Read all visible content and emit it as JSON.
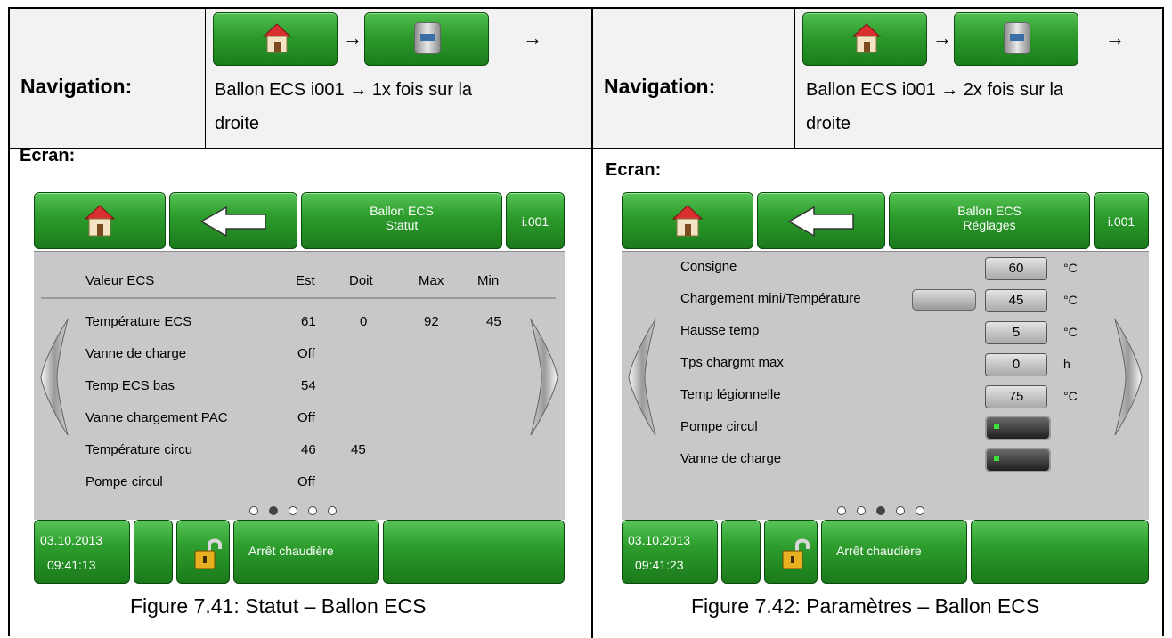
{
  "left": {
    "nav_label": "Navigation:",
    "nav_text_1": "Ballon ECS i001 → 1x fois sur la",
    "nav_text_2": "droite",
    "ecran_label": "Ecran:",
    "screen": {
      "title_line1": "Ballon ECS",
      "title_line2": "Statut",
      "index": "i.001",
      "headers": [
        "Valeur ECS",
        "Est",
        "Doit",
        "Max",
        "Min"
      ],
      "rows": [
        {
          "label": "Température ECS",
          "est": "61",
          "doit": "0",
          "max": "92",
          "min": "45"
        },
        {
          "label": "Vanne de charge",
          "est": "Off",
          "doit": "",
          "max": "",
          "min": ""
        },
        {
          "label": "Temp ECS bas",
          "est": "54",
          "doit": "",
          "max": "",
          "min": ""
        },
        {
          "label": "Vanne chargement PAC",
          "est": "Off",
          "doit": "",
          "max": "",
          "min": ""
        },
        {
          "label": "Température circu",
          "est": "46",
          "doit": "45",
          "max": "",
          "min": ""
        },
        {
          "label": "Pompe circul",
          "est": "Off",
          "doit": "",
          "max": "",
          "min": ""
        }
      ],
      "page_active": 2,
      "page_count": 5,
      "date": "03.10.2013",
      "time": "09:41:13",
      "status": "Arrêt chaudière"
    },
    "caption": "Figure 7.41: Statut – Ballon ECS"
  },
  "right": {
    "nav_label": "Navigation:",
    "nav_text_1": "Ballon ECS i001 → 2x fois sur la",
    "nav_text_2": "droite",
    "ecran_label": "Ecran:",
    "screen": {
      "title_line1": "Ballon ECS",
      "title_line2": "Réglages",
      "index": "i.001",
      "settings": [
        {
          "label": "Consigne",
          "value": "60",
          "unit": "°C"
        },
        {
          "label": "Chargement mini/Température",
          "value": "45",
          "unit": "°C"
        },
        {
          "label": "Hausse temp",
          "value": "5",
          "unit": "°C"
        },
        {
          "label": "Tps chargmt max",
          "value": "0",
          "unit": "h"
        },
        {
          "label": "Temp légionnelle",
          "value": "75",
          "unit": "°C"
        },
        {
          "label": "Pompe circul",
          "value": "",
          "unit": ""
        },
        {
          "label": "Vanne de charge",
          "value": "",
          "unit": ""
        }
      ],
      "page_active": 3,
      "page_count": 5,
      "date": "03.10.2013",
      "time": "09:41:23",
      "status": "Arrêt chaudière"
    },
    "caption": "Figure 7.42: Paramètres – Ballon ECS"
  },
  "colors": {
    "button_green": "#2e9e2e",
    "panel_grey": "#c8c8c8",
    "header_bg": "#f2f2f2"
  }
}
